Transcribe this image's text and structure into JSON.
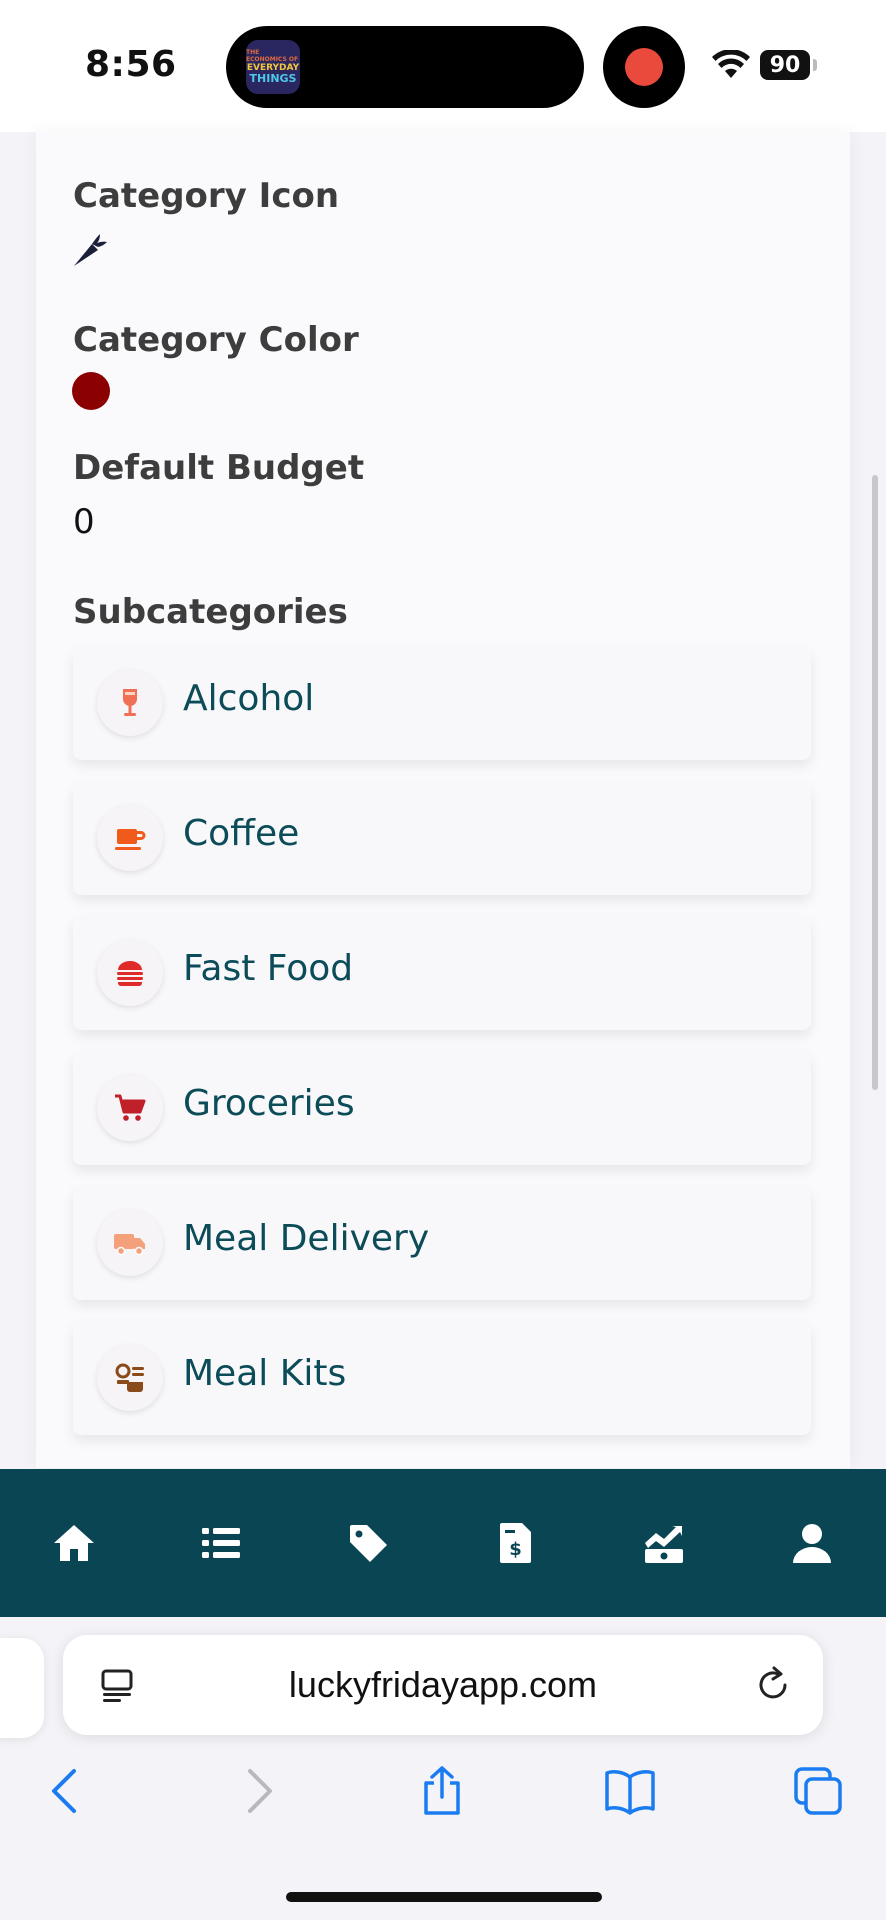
{
  "status_bar": {
    "time": "8:56",
    "battery": "90",
    "island_app_icon_text": [
      "THE ECONOMICS OF",
      "EVERYDAY",
      "THINGS"
    ],
    "recording_color": "#e94a3c"
  },
  "category": {
    "icon_label": "Category Icon",
    "icon": "carrot-icon",
    "color_label": "Category Color",
    "color": "#8b0000",
    "budget_label": "Default Budget",
    "budget_value": "0",
    "subcategories_label": "Subcategories"
  },
  "subcategories": [
    {
      "label": "Alcohol",
      "icon": "wine-glass-icon",
      "icon_color": "#f07055"
    },
    {
      "label": "Coffee",
      "icon": "coffee-mug-icon",
      "icon_color": "#f05a1a"
    },
    {
      "label": "Fast Food",
      "icon": "burger-icon",
      "icon_color": "#e02a2a"
    },
    {
      "label": "Groceries",
      "icon": "shopping-cart-icon",
      "icon_color": "#c0202a"
    },
    {
      "label": "Meal Delivery",
      "icon": "delivery-truck-icon",
      "icon_color": "#f4a07a"
    },
    {
      "label": "Meal Kits",
      "icon": "meal-kit-icon",
      "icon_color": "#8a4a1a"
    }
  ],
  "app_nav": {
    "background": "#0a4553",
    "items": [
      "home-icon",
      "list-icon",
      "tag-icon",
      "invoice-icon",
      "chart-money-icon",
      "user-icon"
    ]
  },
  "browser": {
    "url": "luckyfridayapp.com",
    "accent": "#1a7cf0"
  }
}
